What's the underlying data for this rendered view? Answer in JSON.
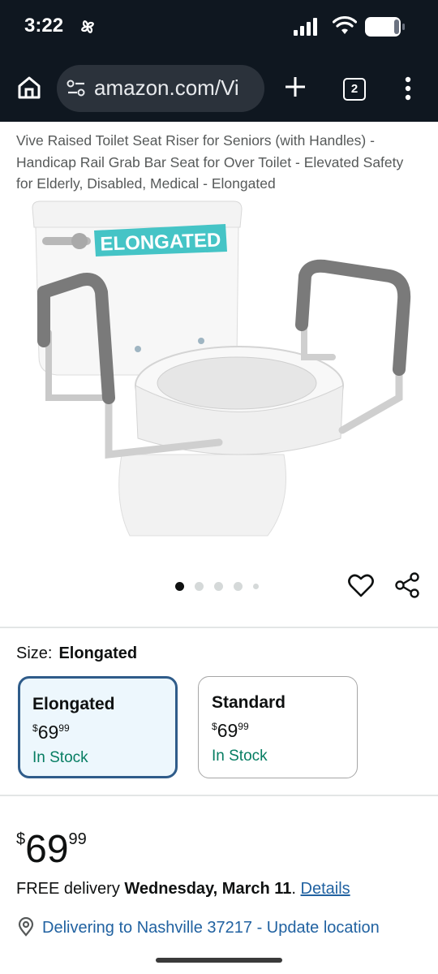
{
  "status_bar": {
    "time": "3:22"
  },
  "browser": {
    "url": "amazon.com/Vi",
    "tab_count": "2"
  },
  "product": {
    "title": "Vive Raised Toilet Seat Riser for Seniors (with Handles) - Handicap Rail Grab Bar Seat for Over Toilet - Elevated Safety for Elderly, Disabled, Medical - Elongated",
    "image_label": "ELONGATED",
    "image_count": 5,
    "current_image": 1
  },
  "size": {
    "label": "Size:",
    "selected": "Elongated",
    "options": [
      {
        "name": "Elongated",
        "currency": "$",
        "price_whole": "69",
        "price_cents": "99",
        "stock": "In Stock",
        "selected": true
      },
      {
        "name": "Standard",
        "currency": "$",
        "price_whole": "69",
        "price_cents": "99",
        "stock": "In Stock",
        "selected": false
      }
    ]
  },
  "price": {
    "currency": "$",
    "whole": "69",
    "cents": "99"
  },
  "delivery": {
    "prefix": "FREE delivery ",
    "date": "Wednesday, March 11",
    "suffix": ". ",
    "details_link": "Details"
  },
  "location": {
    "text": "Delivering to Nashville 37217 - Update location"
  },
  "colors": {
    "stock_green": "#067d62",
    "link_blue": "#2162a1",
    "selected_border": "#2f5c8a",
    "selected_bg": "#edf7fd",
    "label_teal": "#45c4c6"
  }
}
